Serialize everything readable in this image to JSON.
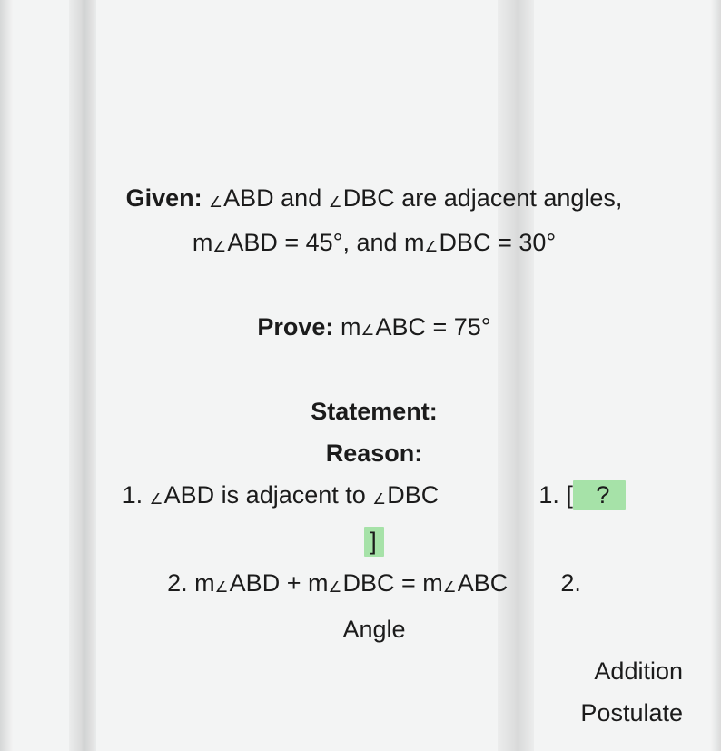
{
  "given": {
    "label": "Given:",
    "line1_before_angle1": " ",
    "angle1": "ABD",
    "between": " and ",
    "angle2": "DBC",
    "after": " are adjacent angles,",
    "line2_prefix": "m",
    "line2_angle1": "ABD",
    "line2_eq1": " = 45°, and m",
    "line2_angle2": "DBC",
    "line2_eq2": " = 30°"
  },
  "prove": {
    "label": "Prove:",
    "prefix": " m",
    "angle": "ABC",
    "suffix": " = 75°"
  },
  "headers": {
    "statement": "Statement:",
    "reason": "Reason:"
  },
  "row1": {
    "num": "1. ",
    "s_angle1": "ABD",
    "s_mid": " is adjacent to ",
    "s_angle2": "DBC",
    "r_num": "1. ",
    "r_open": "[",
    "r_q": "   ?  ",
    "r_close": "]"
  },
  "row2": {
    "num": "2. m",
    "s_angle1": "ABD",
    "s_plus": " +  m",
    "s_angle2": "DBC",
    "s_eq": " = m",
    "s_angle3": "ABC",
    "r_num": "2.",
    "r_word1": "Angle",
    "r_word2": "Addition",
    "r_word3": "Postulate"
  }
}
